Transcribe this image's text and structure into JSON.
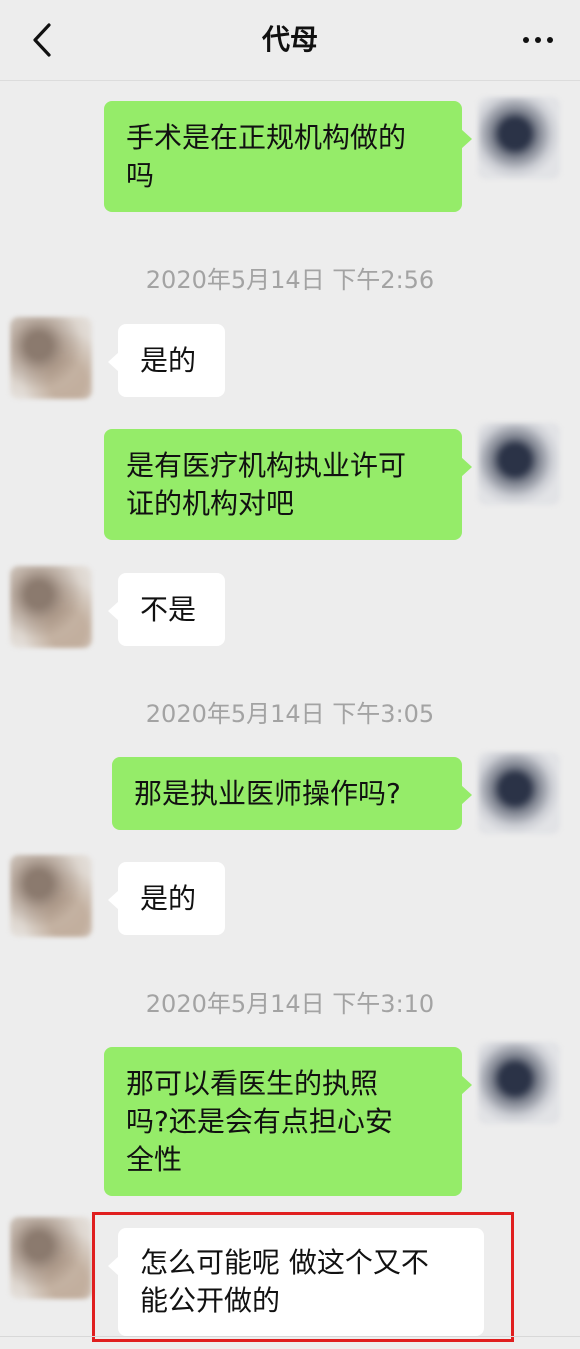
{
  "header": {
    "title": "代母",
    "back_icon": "chevron-left-icon",
    "more_icon": "ellipsis-icon"
  },
  "colors": {
    "background": "#ededed",
    "self_bubble": "#95ec69",
    "other_bubble": "#ffffff",
    "timestamp": "#a3a3a3",
    "highlight_border": "#e01e1e"
  },
  "messages": [
    {
      "sender": "self",
      "text": "手术是在正规机构做的\n吗"
    },
    {
      "timestamp": "2020年5月14日 下午2:56"
    },
    {
      "sender": "other",
      "text": "是的"
    },
    {
      "sender": "self",
      "text": "是有医疗机构执业许可\n证的机构对吧"
    },
    {
      "sender": "other",
      "text": "不是"
    },
    {
      "timestamp": "2020年5月14日 下午3:05"
    },
    {
      "sender": "self",
      "text": "那是执业医师操作吗?"
    },
    {
      "sender": "other",
      "text": "是的"
    },
    {
      "timestamp": "2020年5月14日 下午3:10"
    },
    {
      "sender": "self",
      "text": "那可以看医生的执照\n吗?还是会有点担心安\n全性"
    },
    {
      "sender": "other",
      "text": "怎么可能呢 做这个又不\n能公开做的",
      "highlighted": true
    }
  ]
}
